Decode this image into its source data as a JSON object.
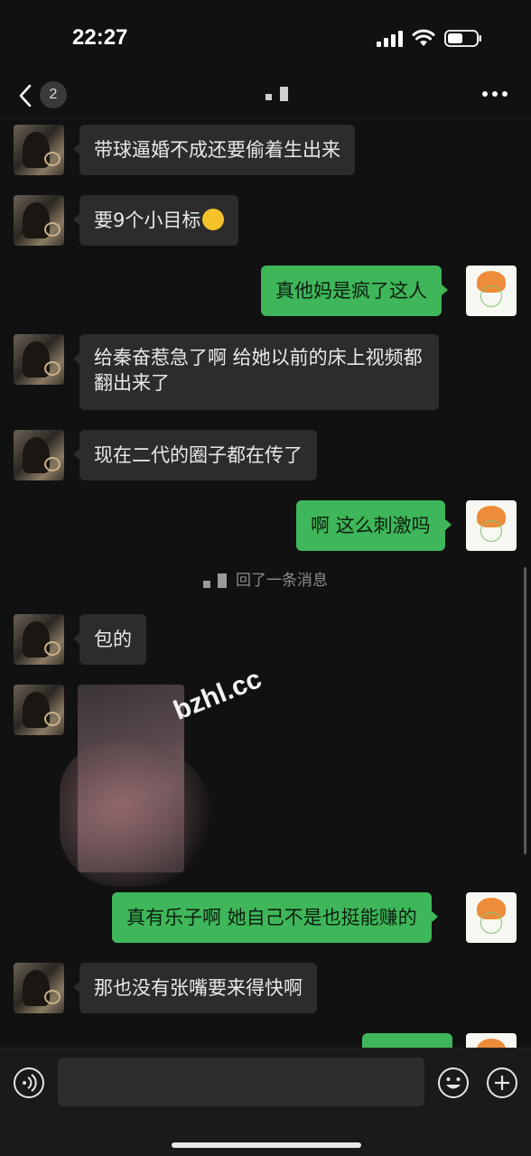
{
  "status_bar": {
    "time": "22:27"
  },
  "nav": {
    "unread_count": "2",
    "back_icon": "chevron-left-icon",
    "more_icon": "more-dots-icon"
  },
  "messages": [
    {
      "side": "left",
      "text": "带球逼婚不成还要偷着生出来"
    },
    {
      "side": "left",
      "text": "要9个小目标",
      "emoji": "laughing-tears-emoji"
    },
    {
      "side": "right",
      "text": "真他妈是疯了这人"
    },
    {
      "side": "left",
      "text": "给秦奋惹急了啊 给她以前的床上视频都翻出来了"
    },
    {
      "side": "left",
      "text": "现在二代的圈子都在传了"
    },
    {
      "side": "right",
      "text": "啊 这么刺激吗"
    },
    {
      "side": "system",
      "text": "回了一条消息"
    },
    {
      "side": "left",
      "text": "包的"
    },
    {
      "side": "left",
      "type": "image"
    },
    {
      "side": "right",
      "text": "真有乐子啊 她自己不是也挺能赚的"
    },
    {
      "side": "left",
      "text": "那也没有张嘴要来得快啊"
    }
  ],
  "watermark": "bzhl.cc",
  "colors": {
    "background": "#111111",
    "left_bubble": "#2c2c2c",
    "right_bubble": "#3eb659",
    "input_bar": "#1a1a1a"
  },
  "input_bar": {
    "voice_icon": "voice-icon",
    "emoji_icon": "smiley-icon",
    "plus_icon": "plus-circle-icon"
  }
}
